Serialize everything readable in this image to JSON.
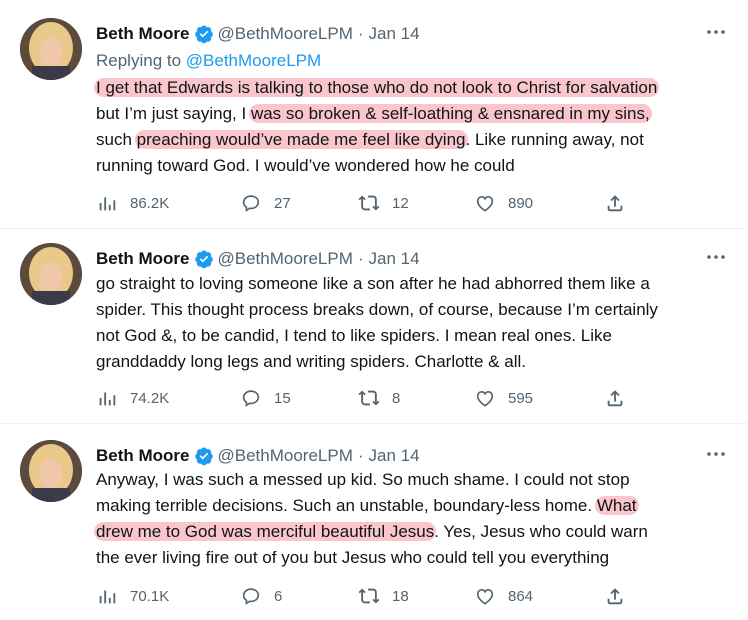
{
  "tweets": [
    {
      "author": "Beth Moore",
      "handle": "@BethMooreLPM",
      "date": "Jan 14",
      "replying_prefix": "Replying to ",
      "replying_to": "@BethMooreLPM",
      "lines": [
        [
          {
            "t": "I get that Edwards is talking to those who do not look to Christ for salvation",
            "hl": true
          }
        ],
        [
          {
            "t": "but I’m just saying, I ",
            "hl": false
          },
          {
            "t": "was so broken & self-loathing & ensnared in my sins,",
            "hl": true
          }
        ],
        [
          {
            "t": "such ",
            "hl": false
          },
          {
            "t": "preaching would’ve made me feel like dying",
            "hl": true
          },
          {
            "t": ". Like running away, not",
            "hl": false
          }
        ],
        [
          {
            "t": "running toward God. I would’ve wondered how he could",
            "hl": false
          }
        ]
      ],
      "views": "86.2K",
      "replies": "27",
      "retweets": "12",
      "likes": "890"
    },
    {
      "author": "Beth Moore",
      "handle": "@BethMooreLPM",
      "date": "Jan 14",
      "lines": [
        [
          {
            "t": "go straight to loving someone like a son after he had abhorred them like a",
            "hl": false
          }
        ],
        [
          {
            "t": "spider. This thought process breaks down, of course, because I’m certainly",
            "hl": false
          }
        ],
        [
          {
            "t": "not God &, to be candid, I tend to like spiders. I mean real ones. Like",
            "hl": false
          }
        ],
        [
          {
            "t": "granddaddy long legs and writing spiders. Charlotte & all.",
            "hl": false
          }
        ]
      ],
      "views": "74.2K",
      "replies": "15",
      "retweets": "8",
      "likes": "595"
    },
    {
      "author": "Beth Moore",
      "handle": "@BethMooreLPM",
      "date": "Jan 14",
      "lines": [
        [
          {
            "t": "Anyway, I was such a messed up kid. So much shame. I could not stop",
            "hl": false
          }
        ],
        [
          {
            "t": "making terrible decisions. Such an unstable, boundary-less home. ",
            "hl": false
          },
          {
            "t": "What",
            "hl": true
          }
        ],
        [
          {
            "t": "drew me to God was merciful beautiful Jesus",
            "hl": true
          },
          {
            "t": ". Yes, Jesus who could warn",
            "hl": false
          }
        ],
        [
          {
            "t": "the ever living fire out of you but Jesus who could tell you everything",
            "hl": false
          }
        ]
      ],
      "views": "70.1K",
      "replies": "6",
      "retweets": "18",
      "likes": "864"
    }
  ],
  "icons": {
    "views": "views-icon",
    "reply": "reply-icon",
    "retweet": "retweet-icon",
    "like": "like-icon",
    "share": "share-icon",
    "verified": "verified-badge-icon",
    "more": "more-icon"
  },
  "colors": {
    "text": "#0f1419",
    "secondary": "#536471",
    "link": "#1d9bf0",
    "verified": "#1d9bf0",
    "highlight": "#f47882"
  }
}
